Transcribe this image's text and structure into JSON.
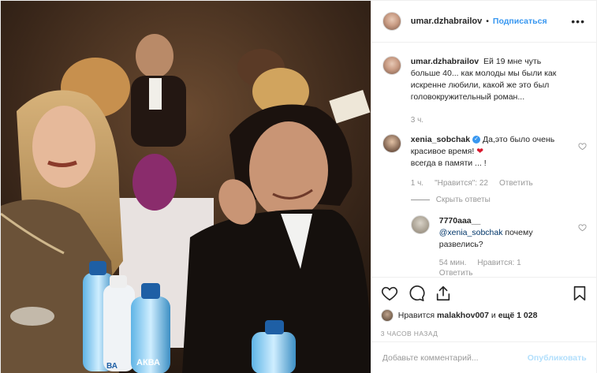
{
  "header": {
    "username": "umar.dzhabrailov",
    "separator": "•",
    "follow_label": "Подписаться",
    "more_label": "•••"
  },
  "caption": {
    "username": "umar.dzhabrailov",
    "text": "Ей 19 мне чуть больше 40... как молоды мы были как искренне любили, какой же это был головокружительный роман...",
    "time": "3 ч."
  },
  "comment1": {
    "username": "xenia_sobchak",
    "text_before": "Да,это было очень красивое время!",
    "heart": "❤",
    "text_after": "всегда в памяти ... !",
    "time": "1 ч.",
    "likes": "\"Нравится\": 22",
    "reply_label": "Ответить",
    "hide_replies": "Скрыть ответы"
  },
  "reply1": {
    "username": "7770aaa__",
    "mention": "@xenia_sobchak",
    "text": "почему развелись?",
    "time": "54 мин.",
    "likes": "Нравится: 1",
    "reply_label": "Ответить"
  },
  "actions": {
    "liked_by_prefix": "Нравится",
    "liked_by_user": "malakhov007",
    "liked_by_and": "и",
    "liked_by_more": "ещё 1 028",
    "timestamp": "3 часов назад"
  },
  "add_comment": {
    "placeholder": "Добавьте комментарий...",
    "publish_label": "Опубликовать"
  },
  "photo": {
    "bottle_label_1": "АКВА",
    "bottle_label_2": "ВА"
  }
}
